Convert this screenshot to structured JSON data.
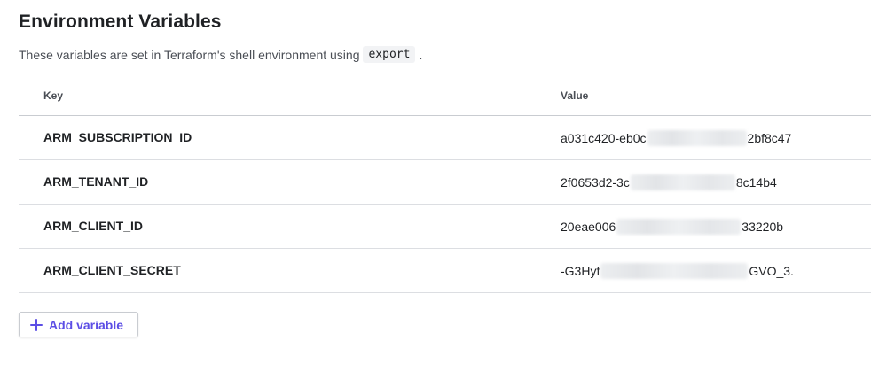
{
  "header": {
    "title": "Environment Variables",
    "description_prefix": "These variables are set in Terraform's shell environment using",
    "description_code": "export",
    "description_suffix": "."
  },
  "table": {
    "columns": {
      "key": "Key",
      "value": "Value"
    },
    "rows": [
      {
        "key": "ARM_SUBSCRIPTION_ID",
        "value_start": "a031c420-eb0c",
        "value_end": "2bf8c47"
      },
      {
        "key": "ARM_TENANT_ID",
        "value_start": "2f0653d2-3c",
        "value_end": "8c14b4"
      },
      {
        "key": "ARM_CLIENT_ID",
        "value_start": "20eae006",
        "value_end": "33220b"
      },
      {
        "key": "ARM_CLIENT_SECRET",
        "value_start": "-G3Hyf",
        "value_end": "GVO_3."
      }
    ]
  },
  "actions": {
    "add_variable_label": "Add variable",
    "add_variable_icon": "plus-icon",
    "accent_color": "#5c4ee5"
  }
}
